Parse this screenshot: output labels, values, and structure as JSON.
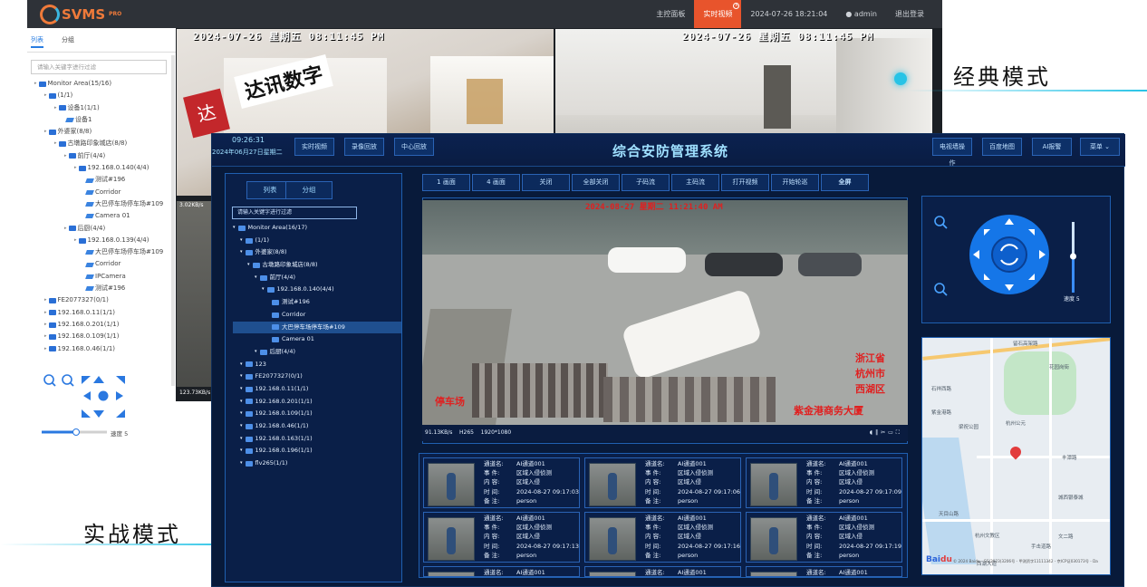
{
  "classic": {
    "logo": "SVMS",
    "logo_sub": "PRO",
    "nav": [
      "主控面板",
      "实时视频"
    ],
    "active_nav": "实时视频",
    "datetime": "2024-07-26 18:21:04",
    "user": "admin",
    "logout": "退出登录",
    "tabs": [
      "列表",
      "分组"
    ],
    "search_placeholder": "请输入关键字进行过滤",
    "tree": [
      {
        "label": "Monitor Area(15/16)",
        "indent": 0,
        "type": "group"
      },
      {
        "label": "(1/1)",
        "indent": 1,
        "type": "group"
      },
      {
        "label": "设备1(1/1)",
        "indent": 2,
        "type": "device"
      },
      {
        "label": "设备1",
        "indent": 3,
        "type": "camera"
      },
      {
        "label": "外婆家(8/8)",
        "indent": 1,
        "type": "group"
      },
      {
        "label": "古墩路印象城店(8/8)",
        "indent": 2,
        "type": "group"
      },
      {
        "label": "前厅(4/4)",
        "indent": 3,
        "type": "group"
      },
      {
        "label": "192.168.0.140(4/4)",
        "indent": 4,
        "type": "device"
      },
      {
        "label": "测试#196",
        "indent": 5,
        "type": "camera"
      },
      {
        "label": "Corridor",
        "indent": 5,
        "type": "camera"
      },
      {
        "label": "大巴停车场停车场#109",
        "indent": 5,
        "type": "camera"
      },
      {
        "label": "Camera 01",
        "indent": 5,
        "type": "camera"
      },
      {
        "label": "后厨(4/4)",
        "indent": 3,
        "type": "group"
      },
      {
        "label": "192.168.0.139(4/4)",
        "indent": 4,
        "type": "device"
      },
      {
        "label": "大巴停车场停车场#109",
        "indent": 5,
        "type": "camera"
      },
      {
        "label": "Corridor",
        "indent": 5,
        "type": "camera"
      },
      {
        "label": "IPCamera",
        "indent": 5,
        "type": "camera"
      },
      {
        "label": "测试#196",
        "indent": 5,
        "type": "camera"
      },
      {
        "label": "FE2077327(0/1)",
        "indent": 1,
        "type": "device"
      },
      {
        "label": "192.168.0.11(1/1)",
        "indent": 1,
        "type": "device"
      },
      {
        "label": "192.168.0.201(1/1)",
        "indent": 1,
        "type": "device"
      },
      {
        "label": "192.168.0.109(1/1)",
        "indent": 1,
        "type": "device"
      },
      {
        "label": "192.168.0.46(1/1)",
        "indent": 1,
        "type": "device"
      }
    ],
    "speed_label": "速度 5",
    "video1_ts": "2024-07-26 星期五 08:11:45 PM",
    "video2_ts": "2024-07-26 星期五 08:11:45 PM",
    "video1_sign": "达讯数字",
    "bitrate1": "3.02KB/s",
    "bitrate2": "123.73KB/s",
    "mode_label": "经典模式"
  },
  "combat": {
    "mode_label": "实战模式",
    "time": "09:26:31",
    "date": "2024年06月27日星期二",
    "head_buttons": [
      "实时视频",
      "录像回放",
      "中心回放"
    ],
    "title": "综合安防管理系统",
    "right_buttons": [
      "电视墙操作",
      "百度地图",
      "AI报警",
      "菜单"
    ],
    "tabs": [
      "列表",
      "分组"
    ],
    "search_placeholder": "请输入关键字进行过滤",
    "tree": [
      {
        "label": "Monitor Area(16/17)",
        "indent": 0
      },
      {
        "label": "(1/1)",
        "indent": 1
      },
      {
        "label": "外婆家(8/8)",
        "indent": 1
      },
      {
        "label": "古墩路印象城店(8/8)",
        "indent": 2
      },
      {
        "label": "前厅(4/4)",
        "indent": 3
      },
      {
        "label": "192.168.0.140(4/4)",
        "indent": 4
      },
      {
        "label": "测试#196",
        "indent": 5
      },
      {
        "label": "Corridor",
        "indent": 5
      },
      {
        "label": "大巴停车场停车场#109",
        "indent": 5,
        "selected": true
      },
      {
        "label": "Camera 01",
        "indent": 5
      },
      {
        "label": "后厨(4/4)",
        "indent": 3
      },
      {
        "label": "123",
        "indent": 1
      },
      {
        "label": "FE2077327(0/1)",
        "indent": 1
      },
      {
        "label": "192.168.0.11(1/1)",
        "indent": 1
      },
      {
        "label": "192.168.0.201(1/1)",
        "indent": 1
      },
      {
        "label": "192.168.0.109(1/1)",
        "indent": 1
      },
      {
        "label": "192.168.0.46(1/1)",
        "indent": 1
      },
      {
        "label": "192.168.0.163(1/1)",
        "indent": 1
      },
      {
        "label": "192.168.0.196(1/1)",
        "indent": 1
      },
      {
        "label": "flv265(1/1)",
        "indent": 1
      }
    ],
    "toolbar": [
      "1 画面",
      "4 画面",
      "关闭",
      "全部关闭",
      "子码流",
      "主码流",
      "打开视频",
      "开始轮巡",
      "全屏"
    ],
    "video_ts": "2024-08-27 星期二 11:21:40 AM",
    "video_overlay_left": "停车场",
    "video_overlay_right": [
      "浙江省",
      "杭州市",
      "西湖区",
      "紫金港商务大厦"
    ],
    "video_stats": {
      "bitrate": "91.13KB/s",
      "codec": "H265",
      "resolution": "1920*1080"
    },
    "speed_label": "速度 5",
    "map_labels": [
      "留石高架路",
      "石祥西路",
      "花园岗街",
      "紫金港路",
      "杭州公元",
      "丰潭路",
      "梁祝公园",
      "杭州文教区",
      "文二路",
      "天目山路",
      "手击道路",
      "城西银泰城",
      "西湖大道",
      "三墩"
    ],
    "map_footer": "© 2024 Baidu - GS(2023)3206号 - 甲测资字11111342 - 京ICP证030173号 - Da",
    "events": [
      {
        "channel": "AI通道001",
        "event": "区域入侵侦测",
        "content": "区域入侵",
        "time": "2024-08-27 09:17:03",
        "note": "person"
      },
      {
        "channel": "AI通道001",
        "event": "区域入侵侦测",
        "content": "区域入侵",
        "time": "2024-08-27 09:17:06",
        "note": "person"
      },
      {
        "channel": "AI通道001",
        "event": "区域入侵侦测",
        "content": "区域入侵",
        "time": "2024-08-27 09:17:09",
        "note": "person"
      },
      {
        "channel": "AI通道001",
        "event": "区域入侵侦测",
        "content": "区域入侵",
        "time": "2024-08-27 09:17:13",
        "note": "person"
      },
      {
        "channel": "AI通道001",
        "event": "区域入侵侦测",
        "content": "区域入侵",
        "time": "2024-08-27 09:17:16",
        "note": "person"
      },
      {
        "channel": "AI通道001",
        "event": "区域入侵侦测",
        "content": "区域入侵",
        "time": "2024-08-27 09:17:19",
        "note": "person"
      },
      {
        "channel": "AI通道001"
      },
      {
        "channel": "AI通道001"
      },
      {
        "channel": "AI通道001"
      }
    ],
    "event_keys": [
      "通道名:",
      "事  件:",
      "内  容:",
      "时  间:",
      "备  注:"
    ]
  },
  "colors": {
    "accent": "#27c3e6",
    "classic_active": "#e8542c",
    "combat_bg": "#081a3a"
  }
}
